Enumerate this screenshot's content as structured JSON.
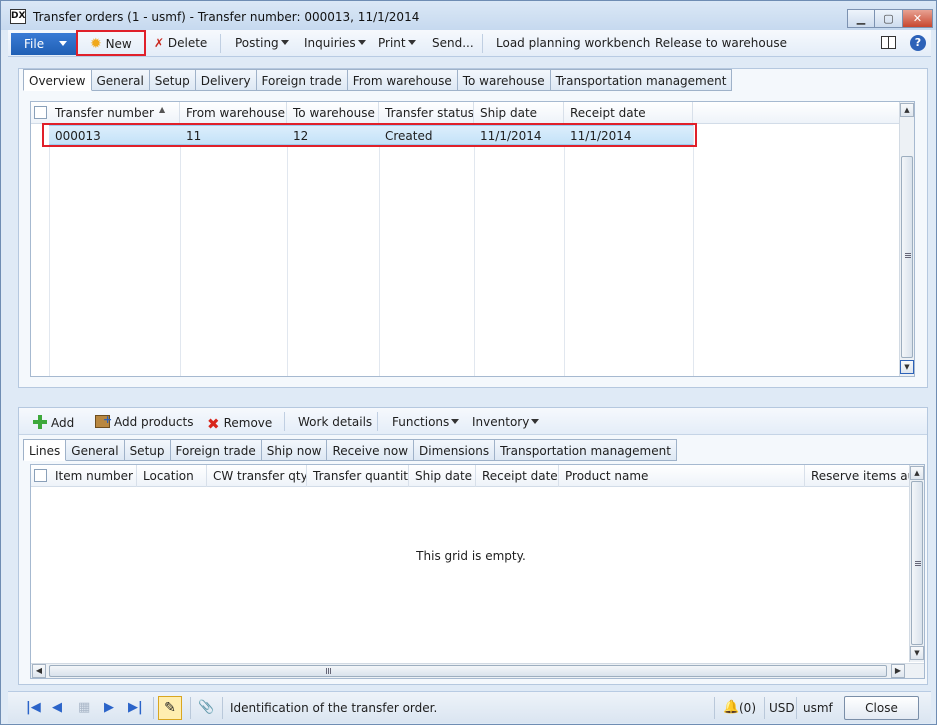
{
  "window": {
    "title": "Transfer orders (1 - usmf) - Transfer number: 000013, 11/1/2014",
    "app_icon_text": "DX"
  },
  "action_pane": {
    "file": "File",
    "new": "New",
    "delete": "Delete",
    "posting": "Posting",
    "inquiries": "Inquiries",
    "print": "Print",
    "send": "Send...",
    "load_planning": "Load planning workbench",
    "release": "Release to warehouse",
    "help": "?"
  },
  "header_tabs": [
    "Overview",
    "General",
    "Setup",
    "Delivery",
    "Foreign trade",
    "From warehouse",
    "To warehouse",
    "Transportation management"
  ],
  "header_grid": {
    "columns": [
      "Transfer number",
      "From warehouse",
      "To warehouse",
      "Transfer status",
      "Ship date",
      "Receipt date"
    ],
    "rows": [
      [
        "000013",
        "11",
        "12",
        "Created",
        "11/1/2014",
        "11/1/2014"
      ]
    ]
  },
  "lines_toolbar": {
    "add": "Add",
    "add_products": "Add products",
    "remove": "Remove",
    "work_details": "Work details",
    "functions": "Functions",
    "inventory": "Inventory"
  },
  "lines_tabs": [
    "Lines",
    "General",
    "Setup",
    "Foreign trade",
    "Ship now",
    "Receive now",
    "Dimensions",
    "Transportation management"
  ],
  "lines_grid": {
    "columns": [
      "Item number",
      "Location",
      "CW transfer qty",
      "Transfer quantity",
      "Ship date",
      "Receipt date",
      "Product name",
      "Reserve items autc"
    ],
    "empty_message": "This grid is empty."
  },
  "status_bar": {
    "message": "Identification of the transfer order.",
    "notifications": "(0)",
    "currency": "USD",
    "company": "usmf",
    "close": "Close"
  },
  "colors": {
    "accent": "#1f5fb4",
    "highlight": "#e0202a",
    "selected_row": "#c4e2f8"
  }
}
